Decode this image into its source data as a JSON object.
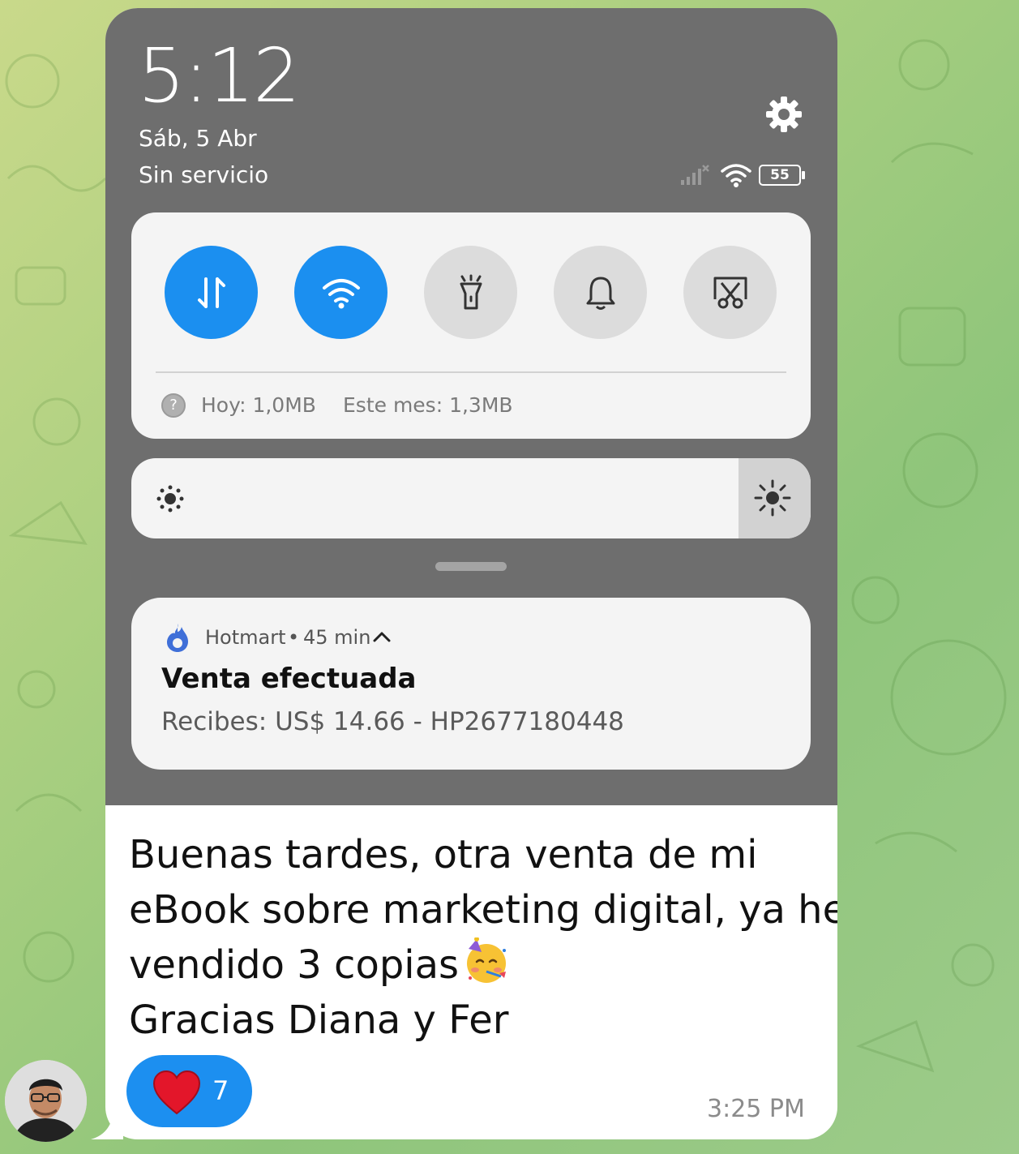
{
  "status_bar": {
    "time": "5:12",
    "date": "Sáb, 5 Abr",
    "carrier": "Sin servicio",
    "battery": "55"
  },
  "quick_settings": {
    "tiles": [
      {
        "name": "mobile-data",
        "icon": "data-arrows-icon",
        "active": true
      },
      {
        "name": "wifi",
        "icon": "wifi-icon",
        "active": true
      },
      {
        "name": "flashlight",
        "icon": "flashlight-icon",
        "active": false
      },
      {
        "name": "sound",
        "icon": "bell-icon",
        "active": false
      },
      {
        "name": "screenshot",
        "icon": "scissors-icon",
        "active": false
      }
    ],
    "usage_today": "Hoy: 1,0MB",
    "usage_month": "Este mes: 1,3MB"
  },
  "notification": {
    "app": "Hotmart",
    "separator": "•",
    "age": "45 min",
    "title": "Venta efectuada",
    "body": "Recibes: US$ 14.66 - HP2677180448"
  },
  "message": {
    "line1": "Buenas tardes, otra venta de mi",
    "line2": "eBook sobre marketing digital, ya he",
    "line3": "vendido 3 copias",
    "line4": "Gracias Diana y Fer",
    "emoji": "partying-face-emoji",
    "reaction_count": "7",
    "timestamp": "3:25 PM"
  },
  "colors": {
    "accent_blue": "#1b8ff0",
    "panel_gray": "#6e6e6e",
    "hotmart_blue": "#3f6fd8"
  }
}
